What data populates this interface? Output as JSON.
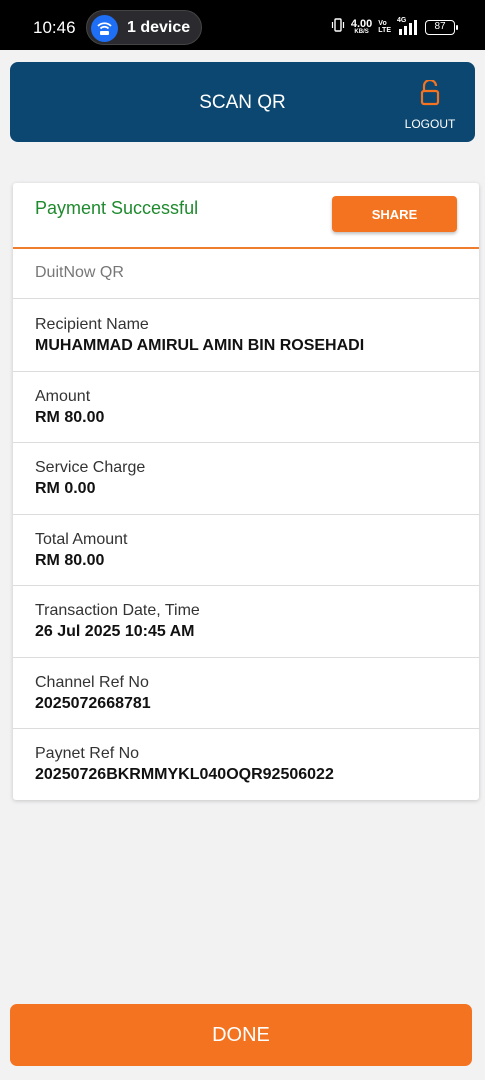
{
  "status_bar": {
    "time": "10:46",
    "hotspot_text": "1 device",
    "net_speed_value": "4.00",
    "net_speed_unit": "KB/S",
    "volte_top": "Vo",
    "volte_bottom": "LTE",
    "network": "4G",
    "battery": "87"
  },
  "header": {
    "title": "SCAN QR",
    "logout_label": "LOGOUT",
    "background": "#0b4770"
  },
  "receipt": {
    "status": "Payment Successful",
    "share_label": "SHARE",
    "service": "DuitNow QR",
    "rows": [
      {
        "label": "Recipient Name",
        "value": "MUHAMMAD AMIRUL AMIN BIN ROSEHADI"
      },
      {
        "label": "Amount",
        "value": "RM 80.00"
      },
      {
        "label": "Service Charge",
        "value": "RM 0.00"
      },
      {
        "label": "Total Amount",
        "value": "RM 80.00"
      },
      {
        "label": "Transaction Date, Time",
        "value": "26 Jul 2025 10:45 AM"
      },
      {
        "label": "Channel Ref No",
        "value": "2025072668781"
      },
      {
        "label": "Paynet Ref No",
        "value": "20250726BKRMMYKL040OQR92506022"
      }
    ]
  },
  "done_label": "DONE",
  "accent_color": "#f47321",
  "success_color": "#1f8a2e"
}
